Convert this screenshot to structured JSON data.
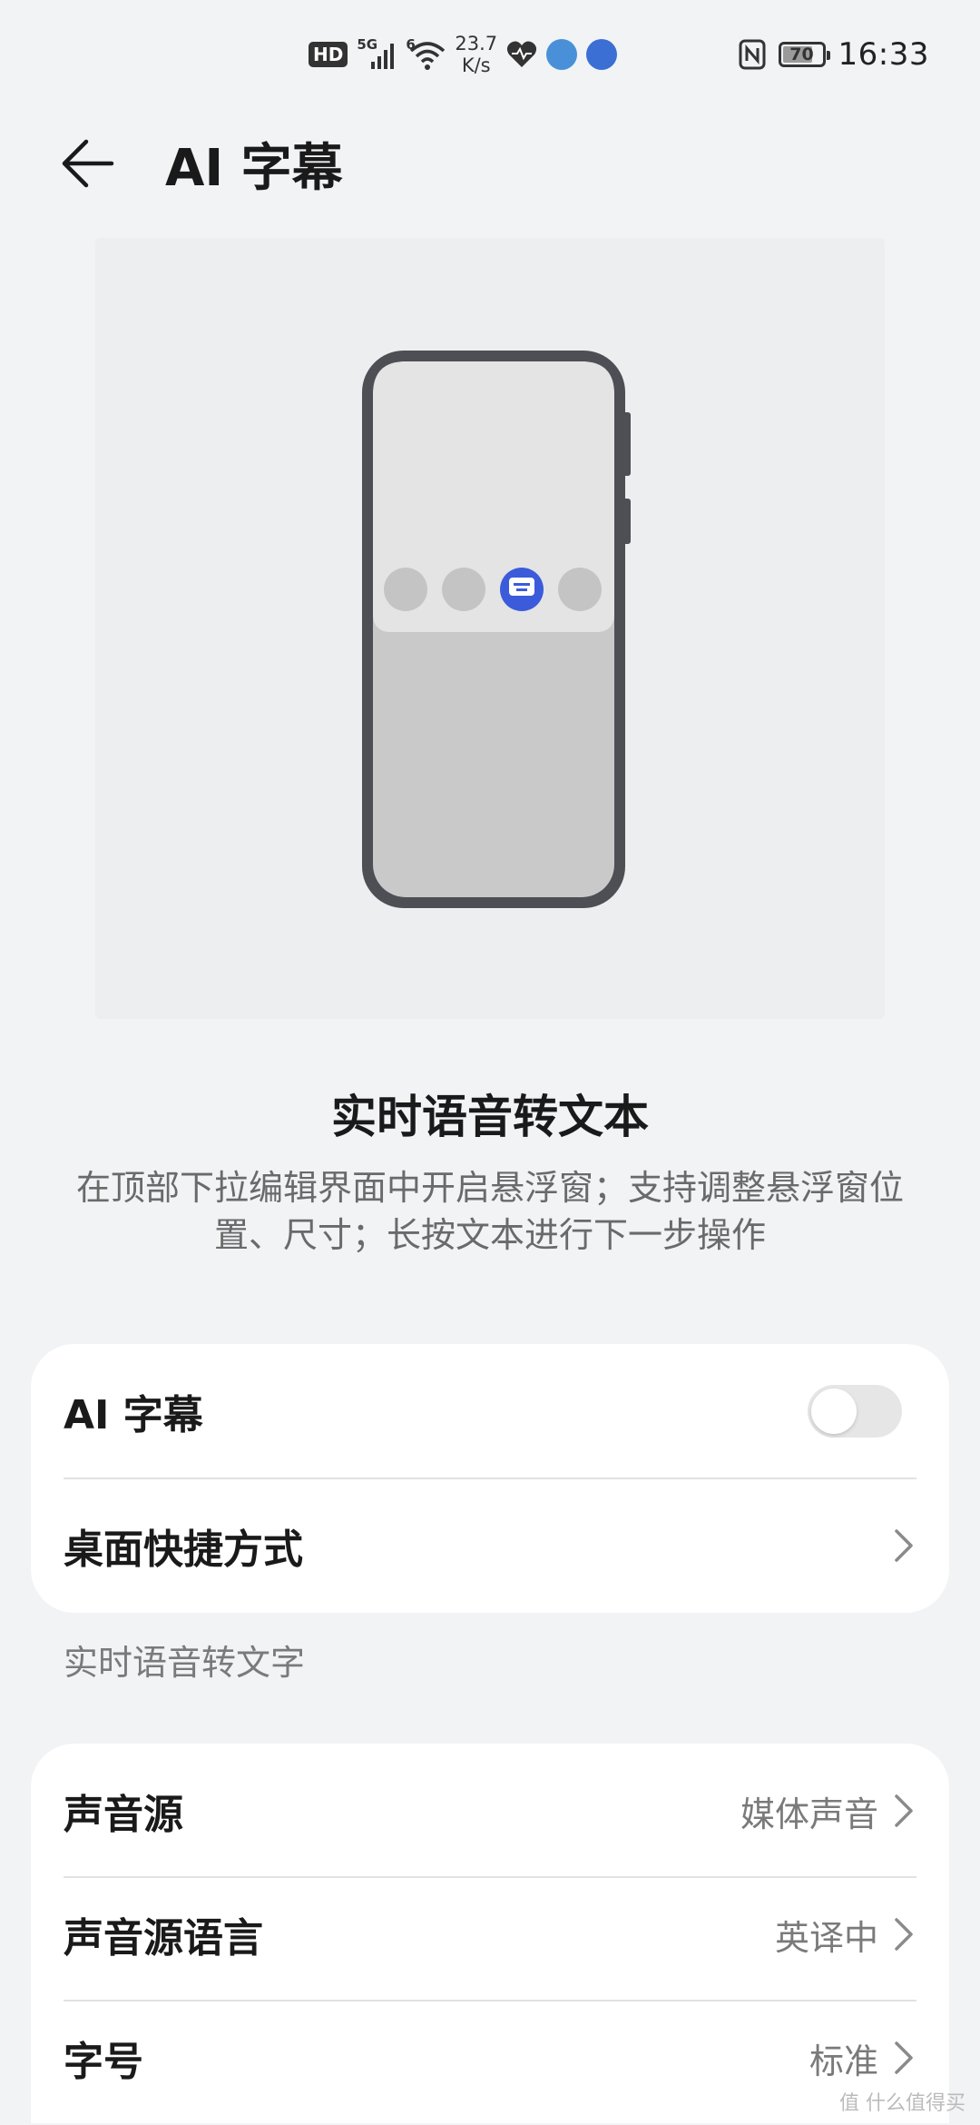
{
  "status_bar": {
    "hd": "HD",
    "network_tag": "5G",
    "wifi_tag": "6",
    "speed_value": "23.7",
    "speed_unit": "K/s",
    "battery": "70",
    "time": "16:33"
  },
  "header": {
    "title": "AI 字幕"
  },
  "hero": {
    "heading": "实时语音转文本",
    "description": "在顶部下拉编辑界面中开启悬浮窗；支持调整悬浮窗位置、尺寸；长按文本进行下一步操作"
  },
  "card1": {
    "toggle_label": "AI 字幕",
    "toggle_on": false,
    "shortcut_label": "桌面快捷方式"
  },
  "section": {
    "label": "实时语音转文字"
  },
  "card2": {
    "rows": [
      {
        "label": "声音源",
        "value": "媒体声音"
      },
      {
        "label": "声音源语言",
        "value": "英译中"
      },
      {
        "label": "字号",
        "value": "标准"
      }
    ]
  },
  "watermark": "值 什么值得买",
  "colors": {
    "accent": "#3b5bdb",
    "background": "#f1f3f5",
    "card": "#ffffff"
  }
}
